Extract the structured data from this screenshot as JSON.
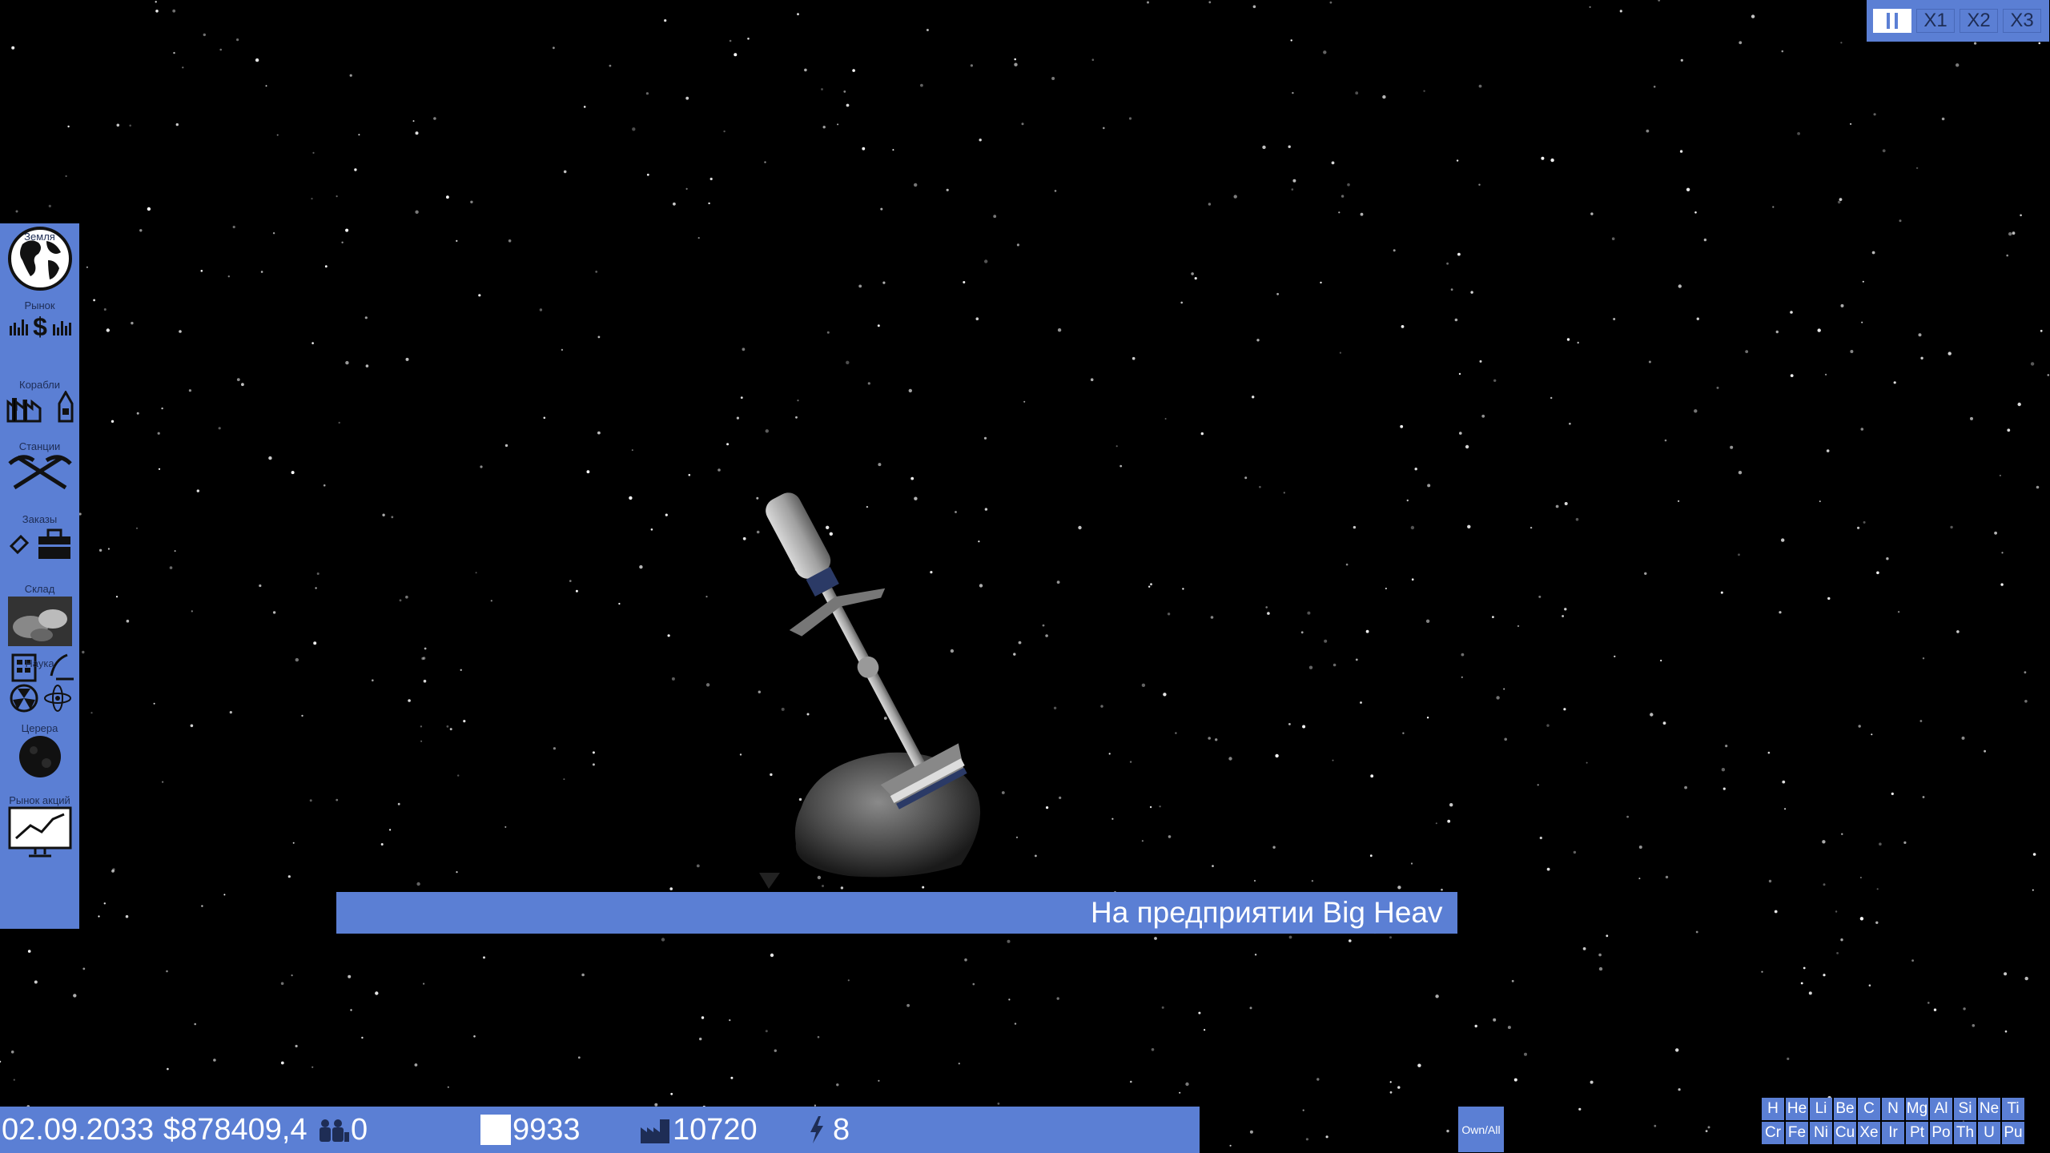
{
  "speed": {
    "buttons": [
      "X1",
      "X2",
      "X3"
    ]
  },
  "sidebar": {
    "items": [
      {
        "label": "Земля",
        "icon": "globe-icon"
      },
      {
        "label": "Рынок",
        "icon": "market-icon"
      },
      {
        "label": "Корабли",
        "icon": "ships-icon"
      },
      {
        "label": "Станции",
        "icon": "stations-icon"
      },
      {
        "label": "Заказы",
        "icon": "orders-icon"
      },
      {
        "label": "Склад",
        "icon": "warehouse-icon"
      },
      {
        "label": "Наука",
        "icon": "science-icon"
      },
      {
        "label": "Церера",
        "icon": "ceres-icon"
      },
      {
        "label": "Рынок акций",
        "icon": "stock-market-icon"
      }
    ]
  },
  "ticker": {
    "text": "На предприятии Big Heav"
  },
  "status": {
    "date": "02.09.2033",
    "money": "$878409,4",
    "population": "0",
    "storage": "9933",
    "production": "10720",
    "energy": "8"
  },
  "own_all": "Own/All",
  "elements": [
    "H",
    "He",
    "Li",
    "Be",
    "C",
    "N",
    "Mg",
    "Al",
    "Si",
    "Ne",
    "Ti",
    "Cr",
    "Fe",
    "Ni",
    "Cu",
    "Xe",
    "Ir",
    "Pt",
    "Po",
    "Th",
    "U",
    "Pu"
  ],
  "colors": {
    "panel": "#5b7fd4",
    "background": "#000000"
  }
}
